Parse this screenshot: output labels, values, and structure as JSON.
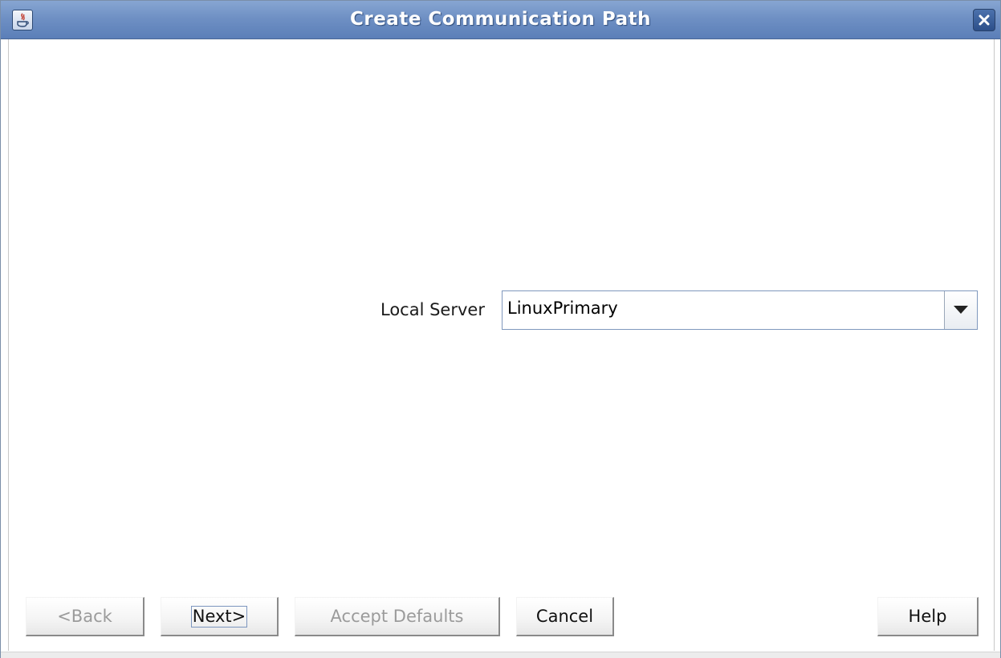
{
  "window": {
    "title": "Create Communication Path"
  },
  "form": {
    "local_server_label": "Local Server",
    "local_server_value": "LinuxPrimary"
  },
  "buttons": {
    "back": "<Back",
    "next": "Next>",
    "accept_defaults": "Accept Defaults",
    "cancel": "Cancel",
    "help": "Help"
  },
  "icons": {
    "app": "java-app-icon",
    "close": "close-icon",
    "dropdown": "chevron-down-icon"
  }
}
